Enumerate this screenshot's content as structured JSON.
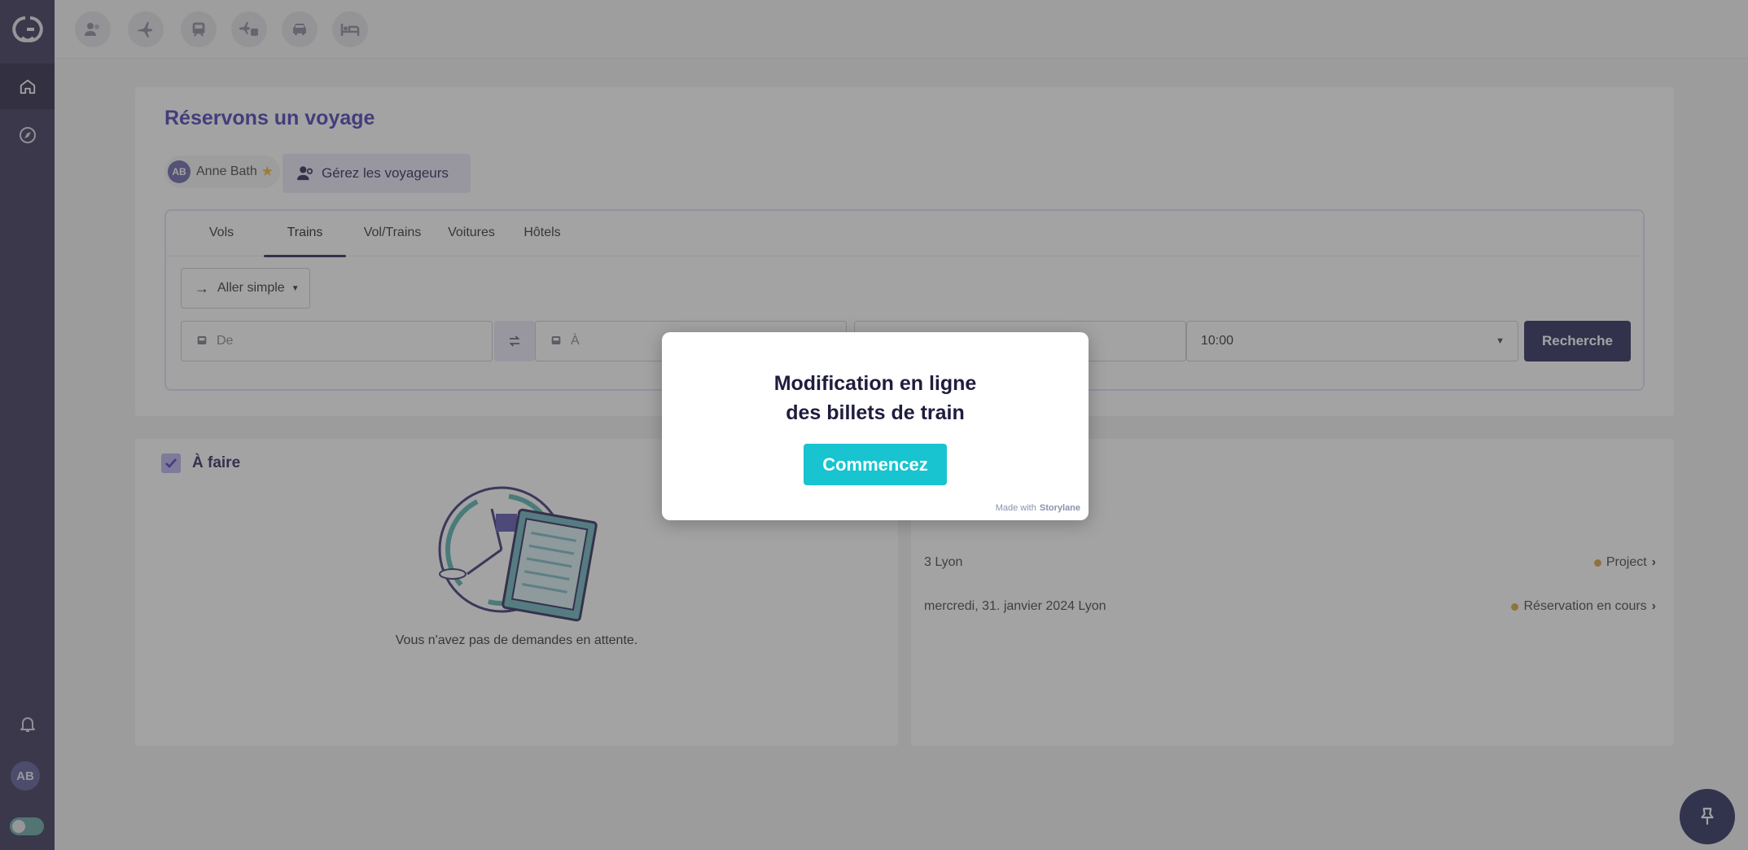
{
  "topbar": {
    "categories": [
      {
        "icon": "users-icon"
      },
      {
        "icon": "plane-icon"
      },
      {
        "icon": "train-icon"
      },
      {
        "icon": "plane-train-icon"
      },
      {
        "icon": "car-icon"
      },
      {
        "icon": "bed-icon"
      }
    ]
  },
  "sidebar": {
    "avatar": "AB"
  },
  "booking": {
    "title": "Réservons un voyage",
    "traveler": {
      "initials": "AB",
      "name": "Anne Bath"
    },
    "manage_label": "Gérez les voyageurs",
    "tabs": [
      {
        "label": "Vols"
      },
      {
        "label": "Trains"
      },
      {
        "label": "Vol/Trains"
      },
      {
        "label": "Voitures"
      },
      {
        "label": "Hôtels"
      }
    ],
    "active_tab": "Trains",
    "trip_type": "Aller simple",
    "from_placeholder": "De",
    "to_placeholder": "À",
    "time_value": "10:00",
    "search_label": "Recherche"
  },
  "todo": {
    "title": "À faire",
    "empty_text": "Vous n'avez pas de demandes en attente."
  },
  "trips": {
    "rows": [
      {
        "date": "3 Lyon",
        "status": "Project"
      },
      {
        "date": "mercredi, 31. janvier 2024 Lyon",
        "status": "Réservation en cours"
      }
    ]
  },
  "modal": {
    "title_line1": "Modification en ligne",
    "title_line2": "des billets de train",
    "cta_label": "Commencez",
    "made_with": "Made with",
    "brand": "Storylane"
  },
  "colors": {
    "sidebar": "#3a3658",
    "accent": "#4a3fb8",
    "primary_button": "#2c2a5e",
    "cta": "#17c4cf",
    "status_dot": "#d9a542"
  }
}
